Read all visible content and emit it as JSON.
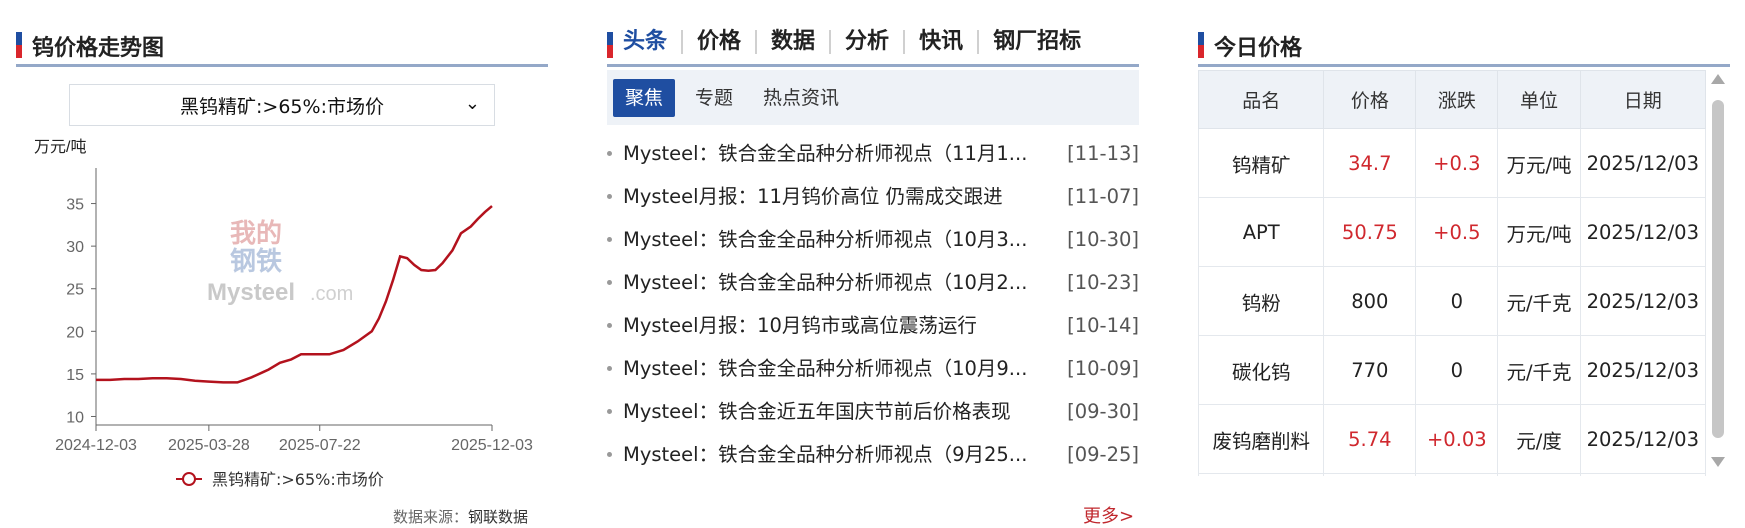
{
  "trend": {
    "title": "钨价格走势图",
    "select_value": "黑钨精矿:>65%:市场价",
    "source_label": "数据来源：",
    "source_value": "钢联数据"
  },
  "chart_data": {
    "type": "line",
    "ylabel": "万元/吨",
    "ylim": [
      9,
      38
    ],
    "yticks": [
      10,
      15,
      20,
      25,
      30,
      35
    ],
    "xticks": [
      "2024-12-03",
      "2025-03-28",
      "2025-07-22",
      "2025-12-03"
    ],
    "series": [
      {
        "name": "黑钨精矿:>65%:市场价",
        "color": "#b3121d",
        "points": [
          [
            0,
            14.3
          ],
          [
            10,
            14.3
          ],
          [
            20,
            14.4
          ],
          [
            30,
            14.4
          ],
          [
            40,
            14.5
          ],
          [
            50,
            14.5
          ],
          [
            60,
            14.4
          ],
          [
            70,
            14.2
          ],
          [
            80,
            14.1
          ],
          [
            90,
            14.0
          ],
          [
            100,
            14.0
          ],
          [
            105,
            14.3
          ],
          [
            110,
            14.6
          ],
          [
            118,
            15.2
          ],
          [
            122,
            15.5
          ],
          [
            130,
            16.3
          ],
          [
            138,
            16.7
          ],
          [
            145,
            17.3
          ],
          [
            155,
            17.3
          ],
          [
            165,
            17.3
          ],
          [
            175,
            17.8
          ],
          [
            185,
            18.8
          ],
          [
            195,
            20.0
          ],
          [
            200,
            21.5
          ],
          [
            205,
            23.5
          ],
          [
            210,
            26.0
          ],
          [
            215,
            28.8
          ],
          [
            220,
            28.6
          ],
          [
            225,
            27.8
          ],
          [
            230,
            27.2
          ],
          [
            235,
            27.1
          ],
          [
            240,
            27.2
          ],
          [
            245,
            28.0
          ],
          [
            252,
            29.5
          ],
          [
            258,
            31.5
          ],
          [
            265,
            32.3
          ],
          [
            270,
            33.2
          ],
          [
            275,
            34.0
          ],
          [
            280,
            34.7
          ]
        ]
      }
    ]
  },
  "news": {
    "tabs": [
      "头条",
      "价格",
      "数据",
      "分析",
      "快讯",
      "钢厂招标"
    ],
    "subtabs": [
      "聚焦",
      "专题",
      "热点资讯"
    ],
    "items": [
      {
        "title": "Mysteel：铁合金全品种分析师视点（11月1...",
        "date": "[11-13]"
      },
      {
        "title": "Mysteel月报：11月钨价高位 仍需成交跟进",
        "date": "[11-07]"
      },
      {
        "title": "Mysteel：铁合金全品种分析师视点（10月3...",
        "date": "[10-30]"
      },
      {
        "title": "Mysteel：铁合金全品种分析师视点（10月2...",
        "date": "[10-23]"
      },
      {
        "title": "Mysteel月报：10月钨市或高位震荡运行",
        "date": "[10-14]"
      },
      {
        "title": "Mysteel：铁合金全品种分析师视点（10月9...",
        "date": "[10-09]"
      },
      {
        "title": "Mysteel：铁合金近五年国庆节前后价格表现",
        "date": "[09-30]"
      },
      {
        "title": "Mysteel：铁合金全品种分析师视点（9月25...",
        "date": "[09-25]"
      }
    ],
    "more": "更多>"
  },
  "prices": {
    "title": "今日价格",
    "headers": [
      "品名",
      "价格",
      "涨跌",
      "单位",
      "日期"
    ],
    "rows": [
      {
        "name": "钨精矿",
        "price": "34.7",
        "change": "+0.3",
        "unit": "万元/吨",
        "date": "2025/12/03"
      },
      {
        "name": "APT",
        "price": "50.75",
        "change": "+0.5",
        "unit": "万元/吨",
        "date": "2025/12/03"
      },
      {
        "name": "钨粉",
        "price": "800",
        "change": "0",
        "unit": "元/千克",
        "date": "2025/12/03"
      },
      {
        "name": "碳化钨",
        "price": "770",
        "change": "0",
        "unit": "元/千克",
        "date": "2025/12/03"
      },
      {
        "name": "废钨磨削料",
        "price": "5.74",
        "change": "+0.03",
        "unit": "元/度",
        "date": "2025/12/03"
      }
    ]
  }
}
